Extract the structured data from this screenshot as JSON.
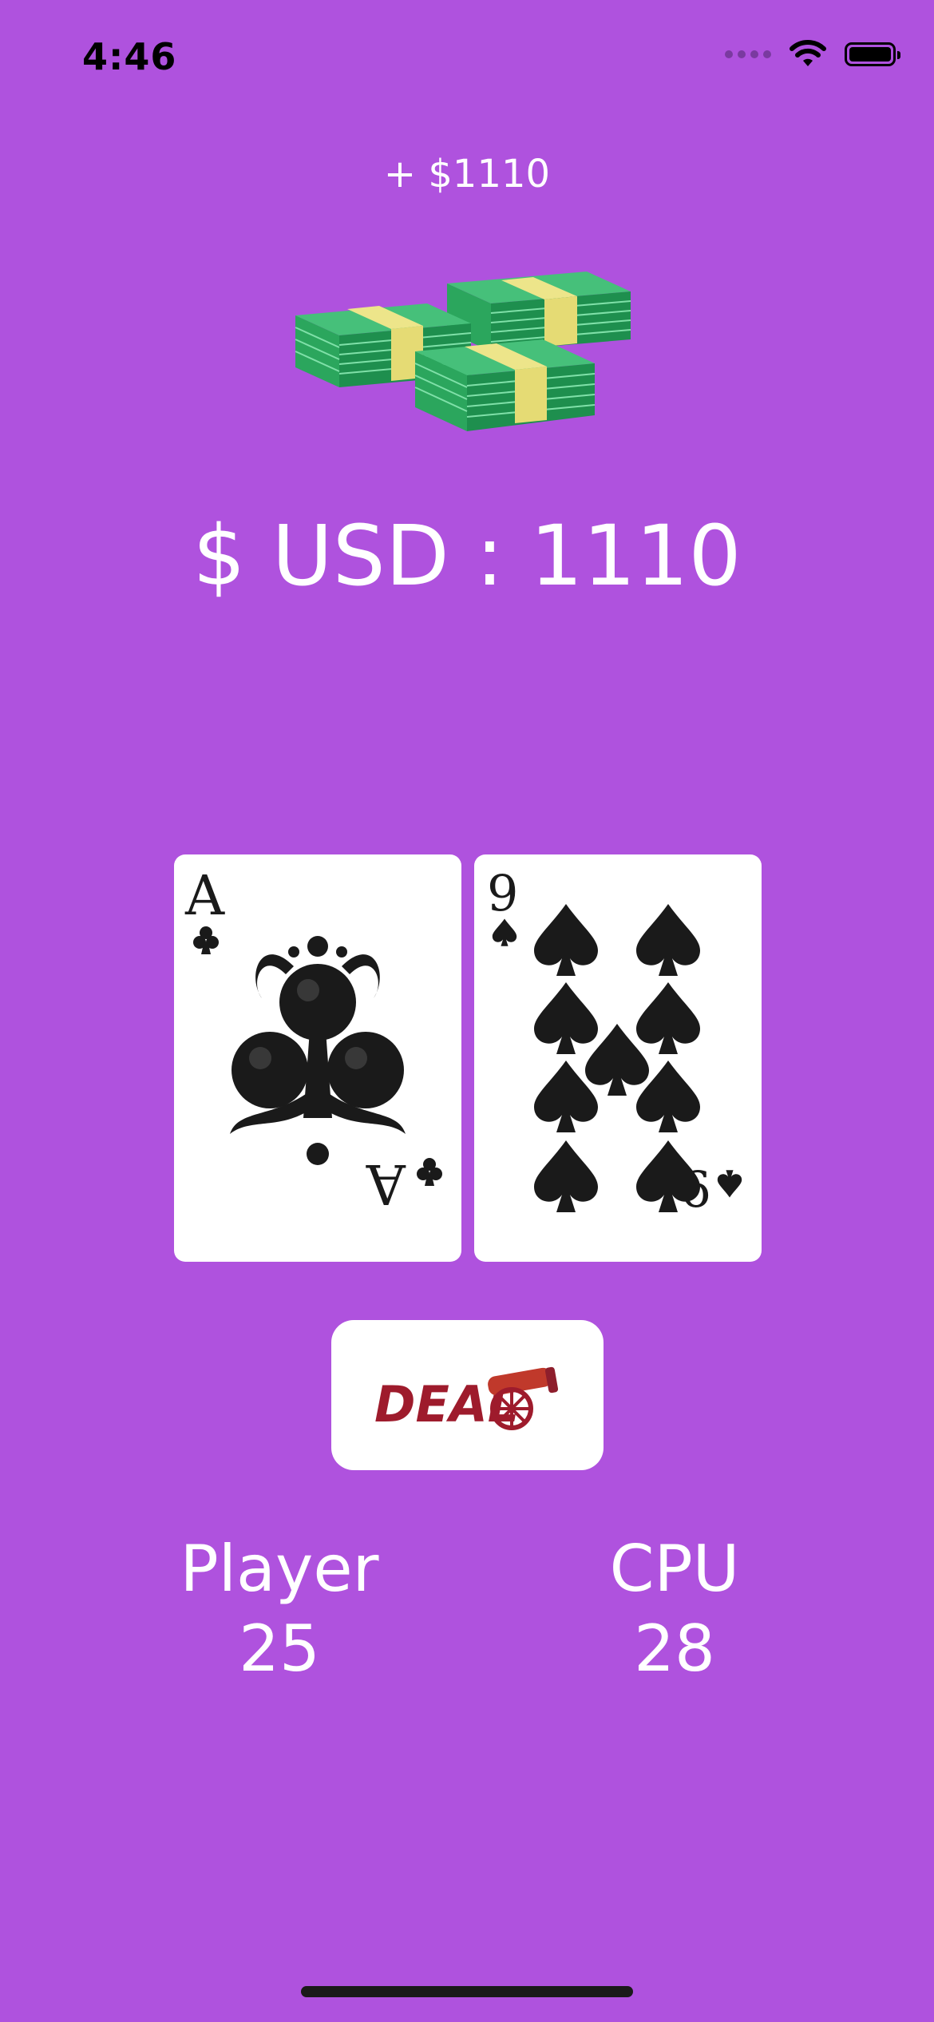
{
  "status_bar": {
    "time": "4:46"
  },
  "bonus_text": "+ $1110",
  "balance_text": "$ USD : 1110",
  "cards": {
    "player": {
      "rank": "A",
      "suit": "clubs"
    },
    "cpu": {
      "rank": "9",
      "suit": "spades"
    }
  },
  "deal_button": {
    "label": "DEAL",
    "icon": "cannon-icon"
  },
  "scores": {
    "player_label": "Player",
    "player_value": "25",
    "cpu_label": "CPU",
    "cpu_value": "28"
  },
  "colors": {
    "background": "#AF52DE",
    "deal_text": "#9E1B2C"
  }
}
